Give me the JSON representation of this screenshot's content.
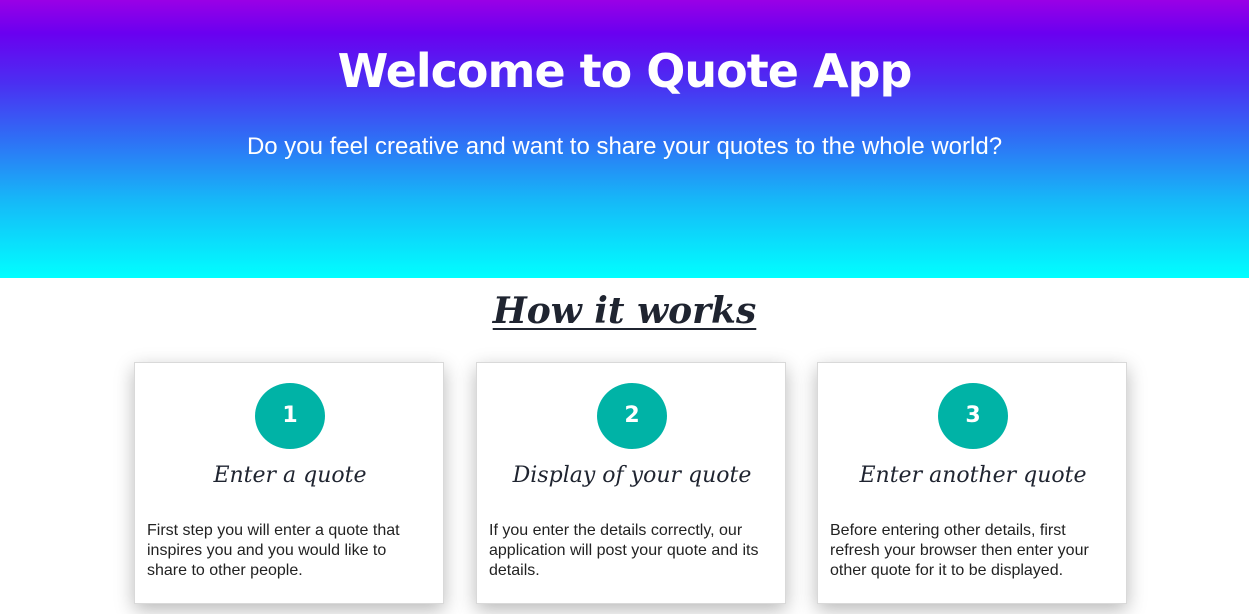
{
  "hero": {
    "title": "Welcome to Quote App",
    "subtitle": "Do you feel creative and want to share your quotes to the whole world?"
  },
  "how_it_works": {
    "title": "How it works",
    "steps": [
      {
        "number": "1",
        "title": "Enter a quote",
        "text": "First step you will enter a quote that inspires you and you would like to share to other people."
      },
      {
        "number": "2",
        "title": "Display of your quote",
        "text": "If you enter the details correctly, our application will post your quote and its details."
      },
      {
        "number": "3",
        "title": "Enter another quote",
        "text": "Before entering other details, first refresh your browser then enter your other quote for it to be displayed."
      }
    ]
  },
  "colors": {
    "gradient_top": "#9a00e6",
    "gradient_bottom": "#00ffff",
    "badge": "#00b3a6"
  }
}
